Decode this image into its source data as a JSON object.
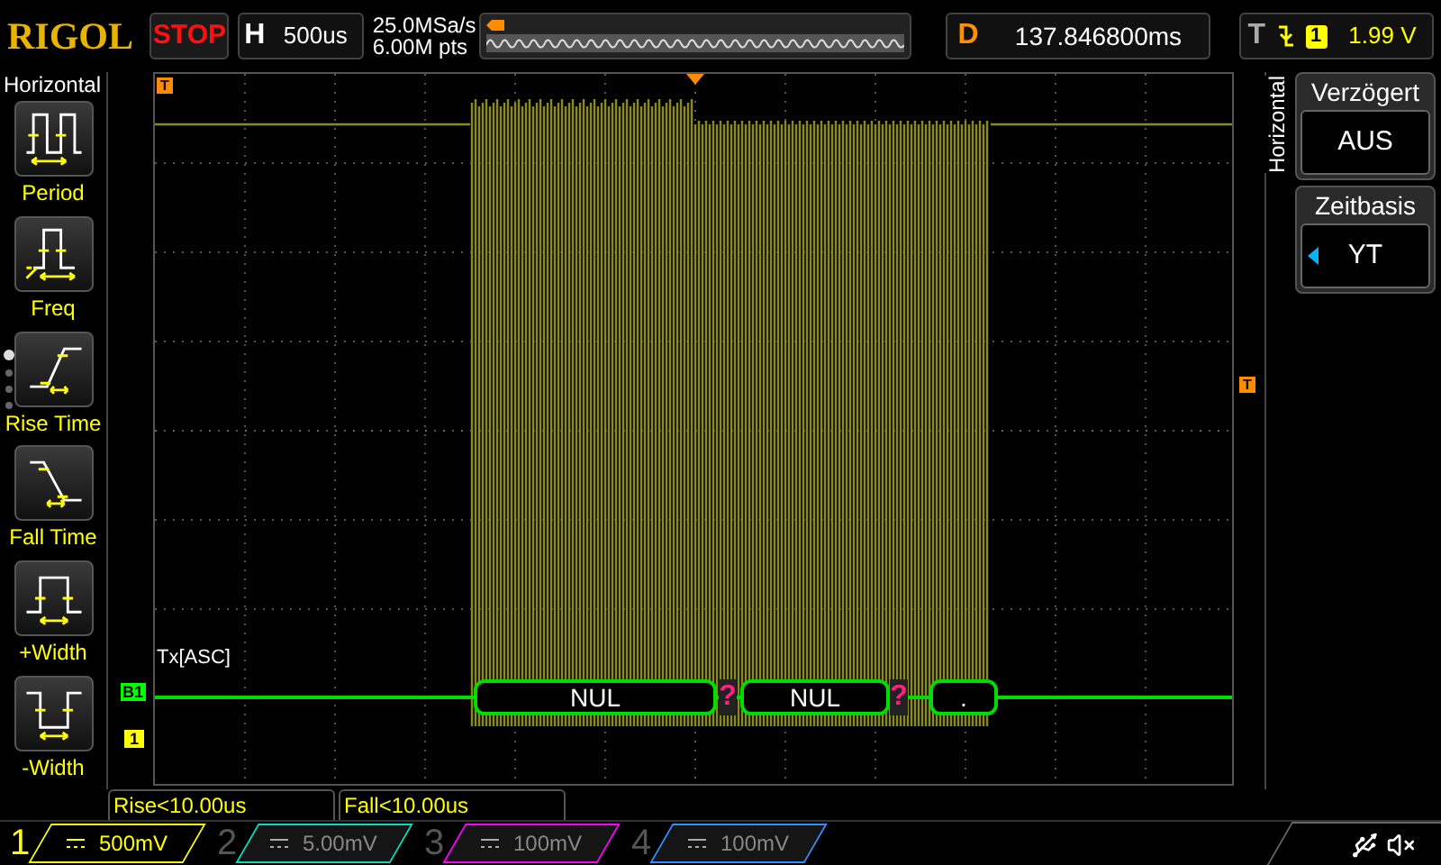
{
  "brand": "RIGOL",
  "run_status": {
    "label": "STOP",
    "running": false
  },
  "horizontal": {
    "label": "H",
    "value": "500us"
  },
  "acquisition": {
    "sample_rate": "25.0MSa/s",
    "memory_depth": "6.00M pts"
  },
  "delay": {
    "label": "D",
    "value": "137.846800ms"
  },
  "trigger": {
    "label": "T",
    "source": "1",
    "level": "1.99 V"
  },
  "left_menu": {
    "title": "Horizontal",
    "pages": [
      {
        "selected": true
      },
      {
        "selected": false
      },
      {
        "selected": false
      },
      {
        "selected": false
      }
    ],
    "items": [
      {
        "kind": "period",
        "label": "Period"
      },
      {
        "kind": "freq",
        "label": "Freq"
      },
      {
        "kind": "rise",
        "label": "Rise Time"
      },
      {
        "kind": "fall",
        "label": "Fall Time"
      },
      {
        "kind": "pwidth",
        "label": "+Width"
      },
      {
        "kind": "nwidth",
        "label": "-Width"
      }
    ]
  },
  "markers": {
    "trigger_left": "T",
    "trigger_right": "T",
    "bus": "B1",
    "channel": "1"
  },
  "decode": {
    "label": "Tx[ASC]",
    "frames": [
      {
        "kind": "frame",
        "text": "NUL"
      },
      {
        "kind": "error",
        "text": "?"
      },
      {
        "kind": "frame",
        "text": "NUL"
      },
      {
        "kind": "error",
        "text": "?"
      },
      {
        "kind": "frame",
        "text": "."
      }
    ]
  },
  "right_menu": {
    "tab": "Horizontal",
    "items": [
      {
        "kind": "value",
        "title": "Verzögert",
        "value": "AUS"
      },
      {
        "kind": "select",
        "title": "Zeitbasis",
        "value": "YT"
      }
    ]
  },
  "measurements": [
    "Rise<10.00us",
    "Fall<10.00us"
  ],
  "channels": [
    {
      "number": "1",
      "scale": "500mV",
      "on": true,
      "color": "#ffff00"
    },
    {
      "number": "2",
      "scale": "5.00mV",
      "on": false,
      "color": "#00e0c0"
    },
    {
      "number": "3",
      "scale": "100mV",
      "on": false,
      "color": "#ff00ff"
    },
    {
      "number": "4",
      "scale": "100mV",
      "on": false,
      "color": "#3090ff"
    }
  ]
}
